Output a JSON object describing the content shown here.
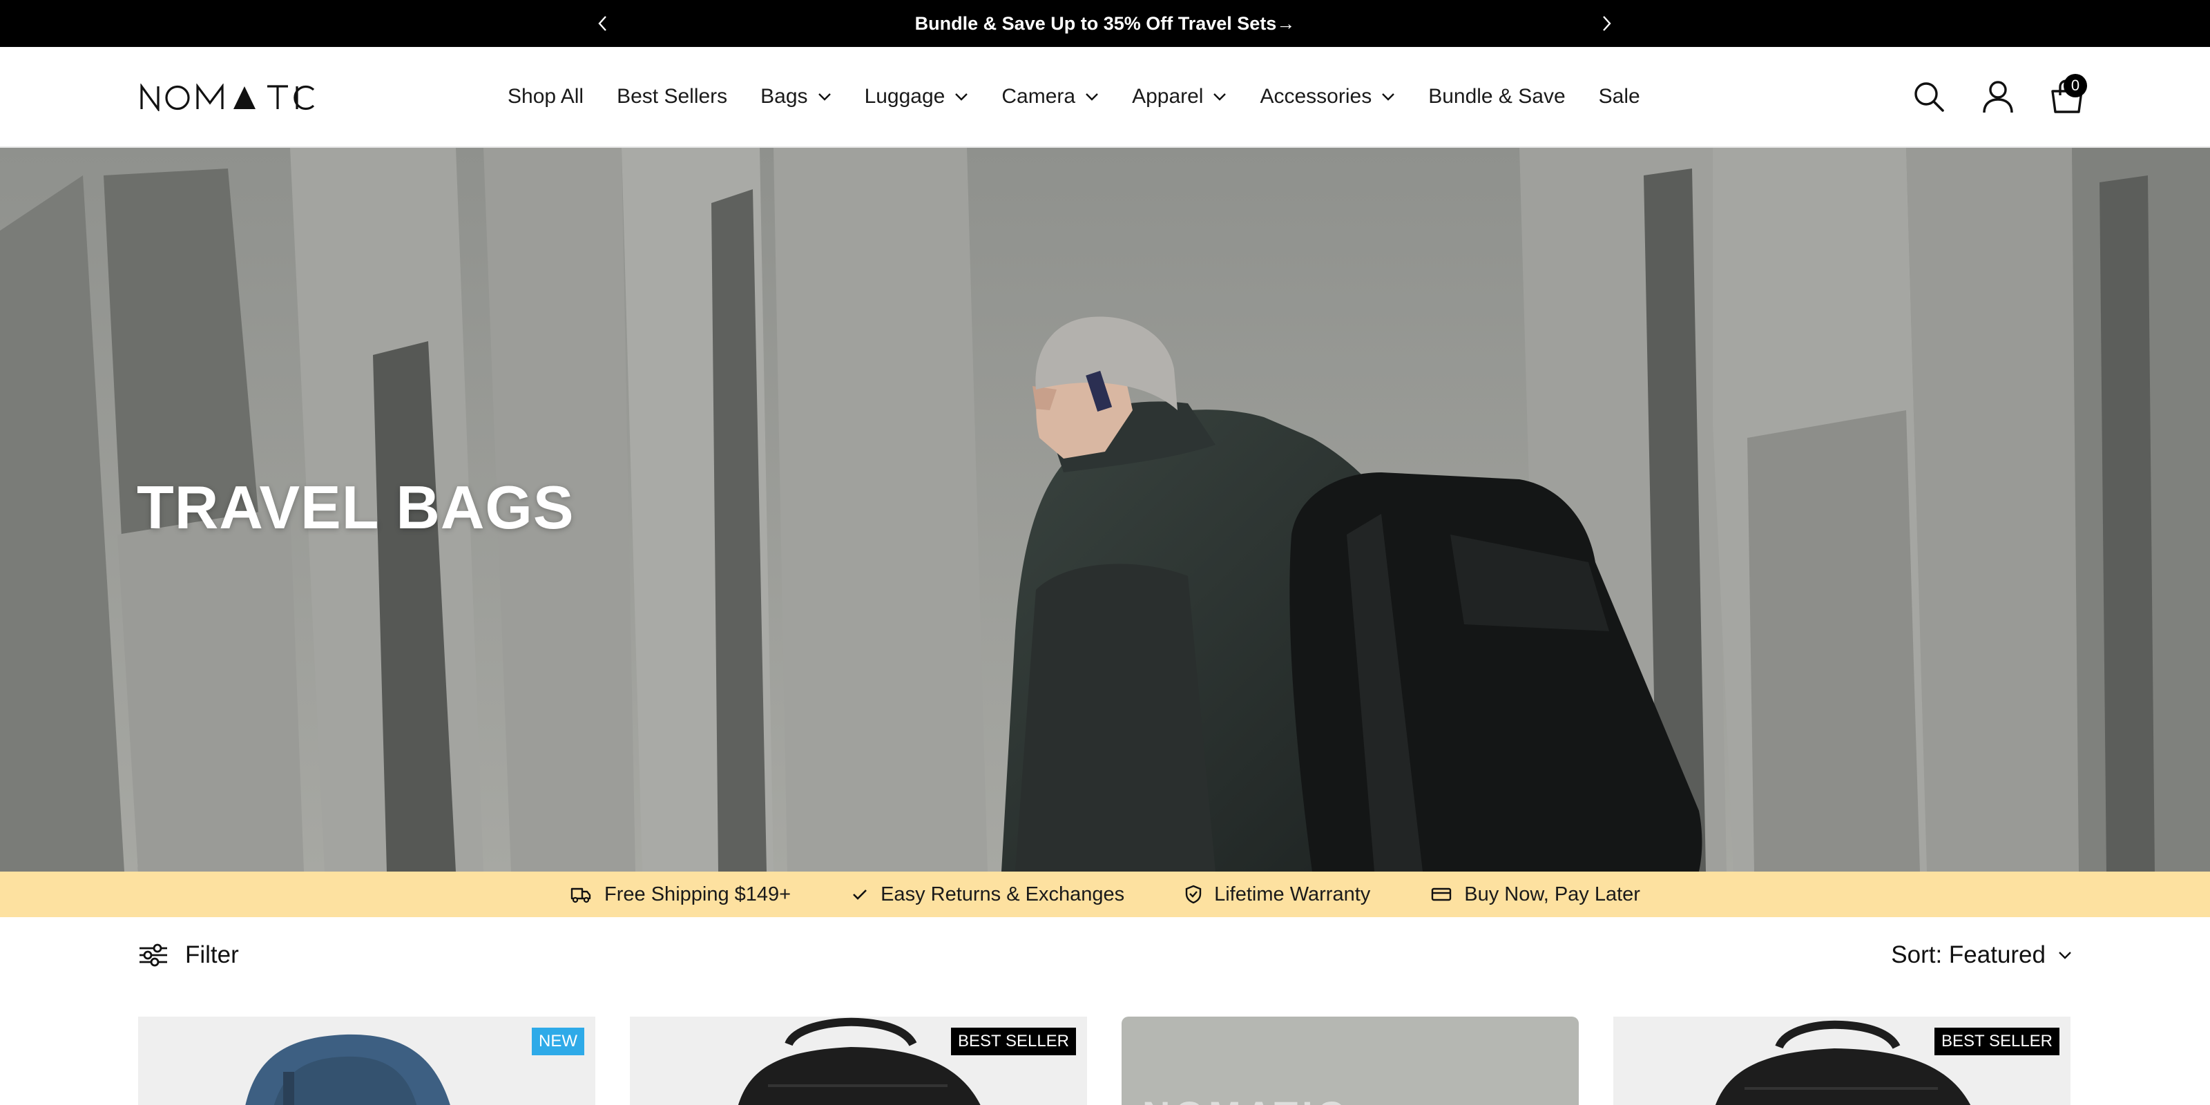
{
  "announcement": {
    "text": "Bundle & Save Up to 35% Off Travel Sets→",
    "prev_icon": "chevron-left-icon",
    "next_icon": "chevron-right-icon"
  },
  "header": {
    "logo_text": "NOMATIC",
    "nav": [
      {
        "label": "Shop All",
        "dropdown": false
      },
      {
        "label": "Best Sellers",
        "dropdown": false
      },
      {
        "label": "Bags",
        "dropdown": true
      },
      {
        "label": "Luggage",
        "dropdown": true
      },
      {
        "label": "Camera",
        "dropdown": true
      },
      {
        "label": "Apparel",
        "dropdown": true
      },
      {
        "label": "Accessories",
        "dropdown": true
      },
      {
        "label": "Bundle & Save",
        "dropdown": false
      },
      {
        "label": "Sale",
        "dropdown": false
      }
    ],
    "icons": [
      "search-icon",
      "account-icon",
      "cart-icon"
    ],
    "cart_count": "0"
  },
  "hero": {
    "title": "TRAVEL BAGS"
  },
  "benefits": [
    {
      "icon": "truck-icon",
      "label": "Free Shipping $149+"
    },
    {
      "icon": "check-icon",
      "label": "Easy Returns & Exchanges"
    },
    {
      "icon": "shield-icon",
      "label": "Lifetime Warranty"
    },
    {
      "icon": "card-icon",
      "label": "Buy Now, Pay Later"
    }
  ],
  "toolbar": {
    "filter_label": "Filter",
    "sort_label": "Sort: Featured"
  },
  "products": [
    {
      "badge": "NEW",
      "badge_type": "new",
      "color": "#3d5f82"
    },
    {
      "badge": "BEST SELLER",
      "badge_type": "best",
      "color": "#1d1d1d"
    },
    {
      "badge": "",
      "badge_type": "promo",
      "promo_text": "NOMATIC"
    },
    {
      "badge": "BEST SELLER",
      "badge_type": "best",
      "color": "#1d1d1d"
    }
  ],
  "colors": {
    "announcement_bg": "#000000",
    "benefits_bg": "#fde1a0",
    "badge_new": "#2eaae8",
    "badge_best": "#000000"
  }
}
